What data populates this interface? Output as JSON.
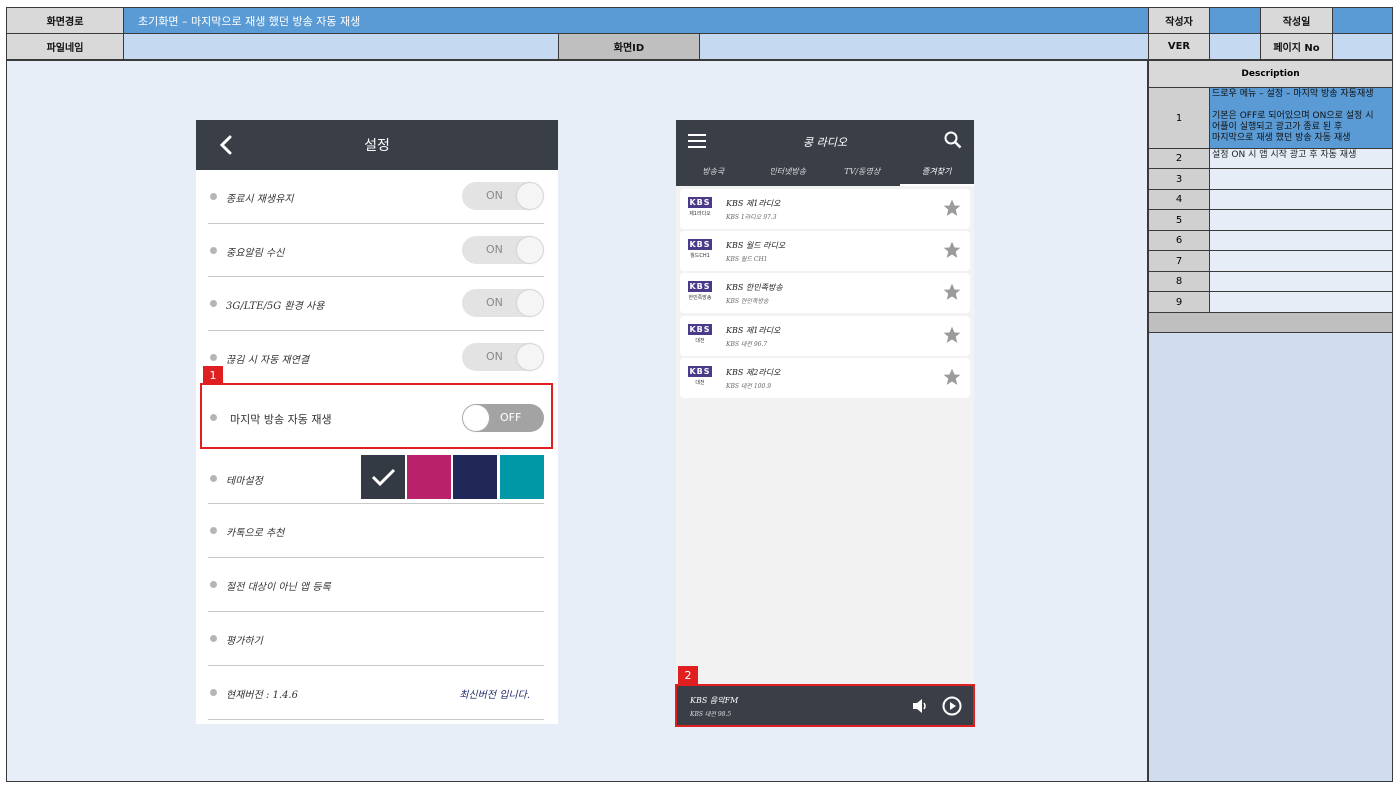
{
  "header": {
    "path_label": "화면경로",
    "path_value": "초기화면 – 마지막으로 재생 했던 방송 자동 재생",
    "author_label": "작성자",
    "date_label": "작성일",
    "file_label": "파일네임",
    "screen_id_label": "화면ID",
    "ver_label": "VER",
    "page_label": "페이지 No"
  },
  "description": {
    "title": "Description",
    "rows": [
      {
        "num": "1",
        "text": "드로우 메뉴 – 설정 – 마지막 방송 자동재생\n\n기본은 OFF로 되어있으며 ON으로 설정 시\n어플이 실행되고 광고가 종료 된 후\n마지막으로 재생 했던 방송 자동 재생"
      },
      {
        "num": "2",
        "text": "설정 ON 시 앱 시작 광고 후 자동 재생"
      },
      {
        "num": "3",
        "text": ""
      },
      {
        "num": "4",
        "text": ""
      },
      {
        "num": "5",
        "text": ""
      },
      {
        "num": "6",
        "text": ""
      },
      {
        "num": "7",
        "text": ""
      },
      {
        "num": "8",
        "text": ""
      },
      {
        "num": "9",
        "text": ""
      }
    ]
  },
  "settings": {
    "title": "설정",
    "items": [
      {
        "label": "종료시 재생유지",
        "toggle": "ON"
      },
      {
        "label": "중요알림 수신",
        "toggle": "ON"
      },
      {
        "label": "3G/LTE/5G 환경 사용",
        "toggle": "ON"
      },
      {
        "label": "끊김 시 자동 재연결",
        "toggle": "ON"
      },
      {
        "label": "마지막 방송 자동 재생",
        "toggle": "OFF"
      },
      {
        "label": "테마설정"
      },
      {
        "label": "카톡으로 추천"
      },
      {
        "label": "절전 대상이 아닌 앱 등록"
      },
      {
        "label": "평가하기"
      },
      {
        "label": "현재버전 : 1.4.6",
        "extra": "최신버전 입니다."
      }
    ],
    "theme_colors": [
      "#343a44",
      "#b9226b",
      "#1f2857",
      "#0097a7"
    ],
    "marker": "1"
  },
  "radio": {
    "title": "콩 라디오",
    "tabs": [
      "방송국",
      "인터넷방송",
      "TV/동영상",
      "즐겨찾기"
    ],
    "stations": [
      {
        "logo": "KBS",
        "sub": "제1라디오",
        "name": "KBS 제1라디오",
        "freq": "KBS 1라디오 97.3"
      },
      {
        "logo": "KBS",
        "sub": "월드CH1",
        "name": "KBS 월드 라디오",
        "freq": "KBS 월드 CH1"
      },
      {
        "logo": "KBS",
        "sub": "한민족방송",
        "name": "KBS 한민족방송",
        "freq": "KBS 한민족방송"
      },
      {
        "logo": "KBS",
        "sub": "대전",
        "name": "KBS 제1라디오",
        "freq": "KBS 대전 96.7"
      },
      {
        "logo": "KBS",
        "sub": "대전",
        "name": "KBS 제2라디오",
        "freq": "KBS 대전 100.9"
      }
    ],
    "player": {
      "name": "KBS 음악FM",
      "freq": "KBS 대전 98.5"
    },
    "marker": "2"
  }
}
